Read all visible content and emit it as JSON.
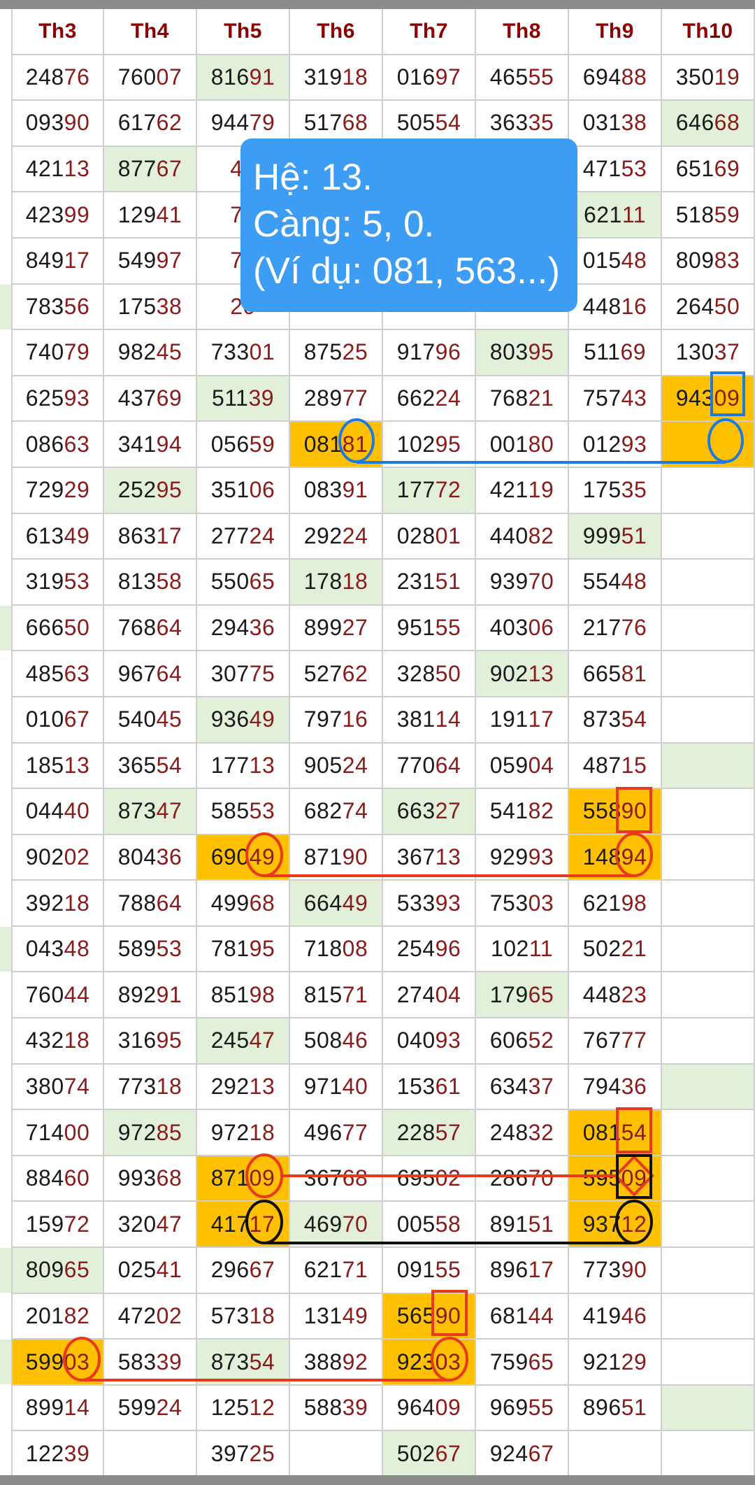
{
  "headers": [
    "Th3",
    "Th4",
    "Th5",
    "Th6",
    "Th7",
    "Th8",
    "Th9",
    "Th10"
  ],
  "rows": [
    [
      "24876",
      "76007",
      "81691",
      "31918",
      "01697",
      "46555",
      "69488",
      "35019"
    ],
    [
      "09390",
      "61762",
      "94479",
      "51768",
      "50554",
      "36335",
      "03138",
      "64668"
    ],
    [
      "42113",
      "87767",
      "48",
      "",
      "",
      "",
      "47153",
      "65169"
    ],
    [
      "42399",
      "12941",
      "79",
      "",
      "",
      "",
      "62111",
      "51859"
    ],
    [
      "84917",
      "54997",
      "78",
      "",
      "",
      "",
      "01548",
      "80983"
    ],
    [
      "78356",
      "17538",
      "20",
      "",
      "",
      "",
      "44816",
      "26450"
    ],
    [
      "74079",
      "98245",
      "73301",
      "87525",
      "91796",
      "80395",
      "51169",
      "13037"
    ],
    [
      "62593",
      "43769",
      "51139",
      "28977",
      "66224",
      "76821",
      "75743",
      "94309"
    ],
    [
      "08663",
      "34194",
      "05659",
      "08181",
      "10295",
      "00180",
      "01293",
      ""
    ],
    [
      "72929",
      "25295",
      "35106",
      "08391",
      "17772",
      "42119",
      "17535",
      ""
    ],
    [
      "61349",
      "86317",
      "27724",
      "29224",
      "02801",
      "44082",
      "99951",
      ""
    ],
    [
      "31953",
      "81358",
      "55065",
      "17818",
      "23151",
      "93970",
      "55448",
      ""
    ],
    [
      "66650",
      "76864",
      "29436",
      "89927",
      "95155",
      "40306",
      "21776",
      ""
    ],
    [
      "48563",
      "96764",
      "30775",
      "52762",
      "32850",
      "90213",
      "66581",
      ""
    ],
    [
      "01067",
      "54045",
      "93649",
      "79716",
      "38114",
      "19117",
      "87354",
      ""
    ],
    [
      "18513",
      "36554",
      "17713",
      "90524",
      "77064",
      "05904",
      "48715",
      ""
    ],
    [
      "04440",
      "87347",
      "58553",
      "68274",
      "66327",
      "54182",
      "55890",
      ""
    ],
    [
      "90202",
      "80436",
      "69049",
      "87190",
      "36713",
      "92993",
      "14894",
      ""
    ],
    [
      "39218",
      "78864",
      "49968",
      "66449",
      "53393",
      "75303",
      "62198",
      ""
    ],
    [
      "04348",
      "58953",
      "78195",
      "71808",
      "25496",
      "10211",
      "50221",
      ""
    ],
    [
      "76044",
      "89291",
      "85198",
      "81571",
      "27404",
      "17965",
      "44823",
      ""
    ],
    [
      "43218",
      "31695",
      "24547",
      "50846",
      "04093",
      "60652",
      "76777",
      ""
    ],
    [
      "38074",
      "77318",
      "29213",
      "97140",
      "15361",
      "63437",
      "79436",
      ""
    ],
    [
      "71400",
      "97285",
      "97218",
      "49677",
      "22857",
      "24832",
      "08154",
      ""
    ],
    [
      "88460",
      "99368",
      "87109",
      "36768",
      "69502",
      "28670",
      "59509",
      ""
    ],
    [
      "15972",
      "32047",
      "41717",
      "46970",
      "00558",
      "89151",
      "93712",
      ""
    ],
    [
      "80965",
      "02541",
      "29667",
      "62171",
      "09155",
      "89617",
      "77390",
      ""
    ],
    [
      "20182",
      "47202",
      "57318",
      "13149",
      "56590",
      "68144",
      "41946",
      ""
    ],
    [
      "59903",
      "58339",
      "87354",
      "38892",
      "92303",
      "75965",
      "92129",
      ""
    ],
    [
      "89914",
      "59924",
      "12512",
      "58839",
      "96409",
      "96955",
      "89651",
      ""
    ],
    [
      "12239",
      "",
      "39725",
      "",
      "50267",
      "92467",
      "",
      ""
    ]
  ],
  "highlights": {
    "green": [
      [
        0,
        2
      ],
      [
        1,
        7
      ],
      [
        2,
        1
      ],
      [
        3,
        6
      ],
      [
        6,
        5
      ],
      [
        7,
        2
      ],
      [
        9,
        1
      ],
      [
        9,
        4
      ],
      [
        10,
        6
      ],
      [
        11,
        3
      ],
      [
        13,
        5
      ],
      [
        14,
        2
      ],
      [
        15,
        7
      ],
      [
        16,
        1
      ],
      [
        16,
        4
      ],
      [
        18,
        3
      ],
      [
        20,
        5
      ],
      [
        21,
        2
      ],
      [
        22,
        7
      ],
      [
        23,
        1
      ],
      [
        23,
        4
      ],
      [
        25,
        3
      ],
      [
        26,
        0
      ],
      [
        28,
        2
      ],
      [
        29,
        7
      ],
      [
        30,
        4
      ]
    ],
    "yellow": [
      [
        7,
        7
      ],
      [
        8,
        3
      ],
      [
        8,
        7
      ],
      [
        16,
        6
      ],
      [
        17,
        2
      ],
      [
        17,
        6
      ],
      [
        23,
        6
      ],
      [
        24,
        2
      ],
      [
        24,
        6
      ],
      [
        25,
        2
      ],
      [
        25,
        6
      ],
      [
        27,
        4
      ],
      [
        28,
        0
      ],
      [
        28,
        4
      ]
    ],
    "edge_green_rows": [
      5,
      12,
      19,
      26,
      28
    ]
  },
  "tooltip": {
    "line1": "Hệ: 13.",
    "line2": "Càng: 5, 0.",
    "line3": "(Ví dụ: 081, 563...)"
  },
  "colors": {
    "header_text": "#8b0000",
    "tail_digits": "#8b1a1a",
    "green_cell": "#e2f0d9",
    "yellow_cell": "#ffc000",
    "tooltip_bg": "#3d9df5",
    "mark_red": "#e8391d",
    "mark_blue": "#1f7ae0",
    "mark_black": "#111111"
  }
}
